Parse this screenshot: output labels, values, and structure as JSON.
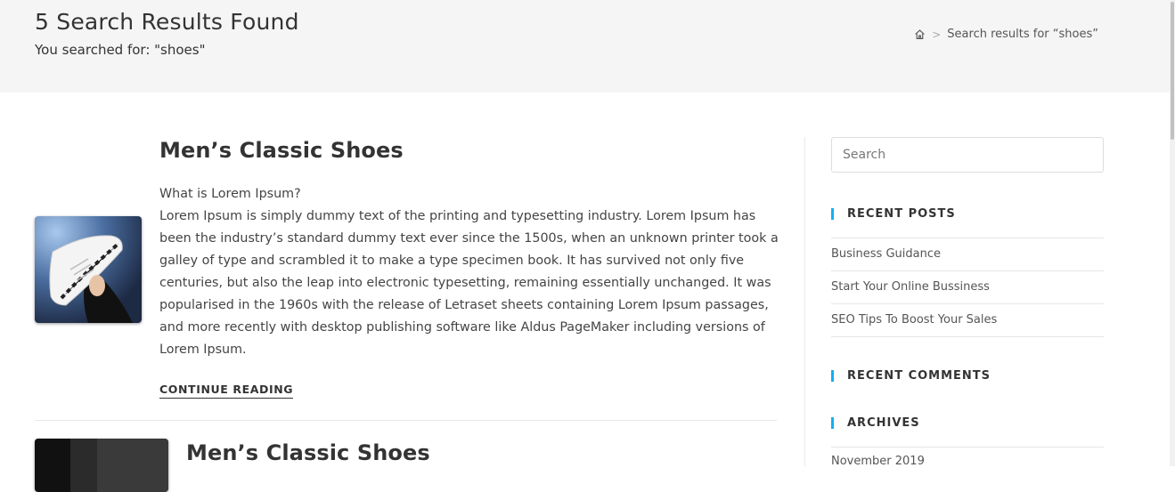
{
  "page_header": {
    "title": "5 Search Results Found",
    "subheading": "You searched for: \"shoes\""
  },
  "breadcrumb": {
    "home_icon": "home-icon",
    "separator": ">",
    "current": "Search results for “shoes”"
  },
  "posts": [
    {
      "title": "Men’s Classic Shoes",
      "thumbnail_icon": "shoe-image",
      "excerpt_heading": "What is Lorem Ipsum?",
      "excerpt_body": "Lorem Ipsum is simply dummy text of the printing and typesetting industry. Lorem Ipsum has been the industry’s standard dummy text ever since the 1500s, when an unknown printer took a galley of type and scrambled it to make a type specimen book. It has survived not only five centuries, but also the leap into electronic typesetting, remaining essentially unchanged. It was popularised in the 1960s with the release of Letraset sheets containing Lorem Ipsum passages, and more recently with desktop publishing software like Aldus PageMaker including versions of Lorem Ipsum.",
      "continue_label": "Continue Reading"
    },
    {
      "title": "Men’s Classic Shoes",
      "thumbnail_icon": "shoe-image"
    }
  ],
  "sidebar": {
    "search_placeholder": "Search",
    "recent_posts_title": "Recent Posts",
    "recent_posts": [
      "Business Guidance",
      "Start Your Online Bussiness",
      "SEO Tips To Boost Your Sales"
    ],
    "recent_comments_title": "Recent Comments",
    "archives_title": "Archives",
    "archives": [
      "November 2019"
    ]
  },
  "colors": {
    "header_bg": "#f5f5f5",
    "accent": "#13aff0",
    "text": "#333333"
  }
}
